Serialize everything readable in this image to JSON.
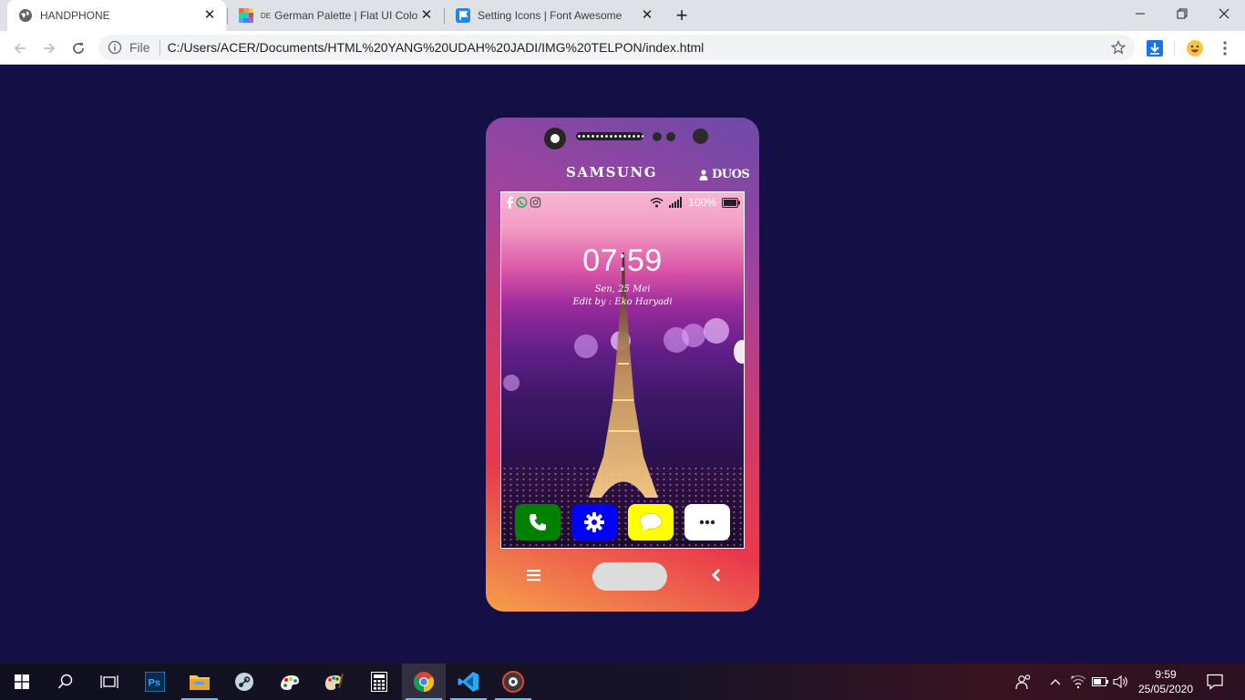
{
  "browser": {
    "tabs": [
      {
        "title": "HANDPHONE",
        "active": true
      },
      {
        "title": "German Palette | Flat UI Colors",
        "prefix": "DE",
        "active": false
      },
      {
        "title": "Setting Icons | Font Awesome",
        "active": false
      }
    ],
    "omnibox": {
      "scheme_label": "File",
      "url": "C:/Users/ACER/Documents/HTML%20YANG%20UDAH%20JADI/IMG%20TELPON/index.html"
    }
  },
  "phone": {
    "brand": "SAMSUNG",
    "model_badge": "DUOS",
    "status_bar": {
      "social_icons": [
        "facebook-icon",
        "whatsapp-icon",
        "instagram-icon"
      ],
      "battery_percent": "100%"
    },
    "lockscreen": {
      "time": "07:59",
      "date": "Sen, 25 Mei",
      "credit": "Edit by : Eko Haryadi"
    },
    "dock": [
      {
        "name": "phone",
        "icon": "phone-icon",
        "color": "#008000"
      },
      {
        "name": "settings",
        "icon": "gear-icon",
        "color": "#0000ff"
      },
      {
        "name": "messages",
        "icon": "chat-bubble-icon",
        "color": "#ffff00"
      },
      {
        "name": "more",
        "icon": "ellipsis-icon",
        "color": "#ffffff"
      }
    ]
  },
  "taskbar": {
    "apps": [
      "start",
      "search",
      "task-view",
      "photoshop",
      "file-explorer",
      "steam",
      "paint-3d",
      "paint",
      "calculator",
      "chrome",
      "vs-code",
      "media-app"
    ],
    "clock_time": "9:59",
    "clock_date": "25/05/2020"
  },
  "colors": {
    "page_background": "#141046",
    "dock_phone": "#008000",
    "dock_settings": "#0000ff",
    "dock_messages": "#ffff00"
  }
}
